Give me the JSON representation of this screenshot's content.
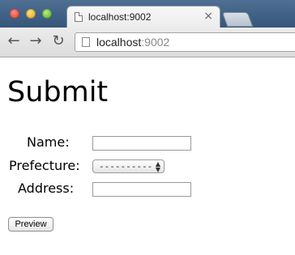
{
  "browser": {
    "tab_title": "localhost:9002",
    "tab_close": "×",
    "url_host": "localhost",
    "url_port": ":9002",
    "icons": {
      "back": "←",
      "forward": "→",
      "reload": "↻"
    }
  },
  "page": {
    "heading": "Submit",
    "form": {
      "name_label": "Name:",
      "name_value": "",
      "prefecture_label": "Prefecture:",
      "prefecture_selected": "----------",
      "address_label": "Address:",
      "address_value": "",
      "preview_label": "Preview"
    }
  }
}
